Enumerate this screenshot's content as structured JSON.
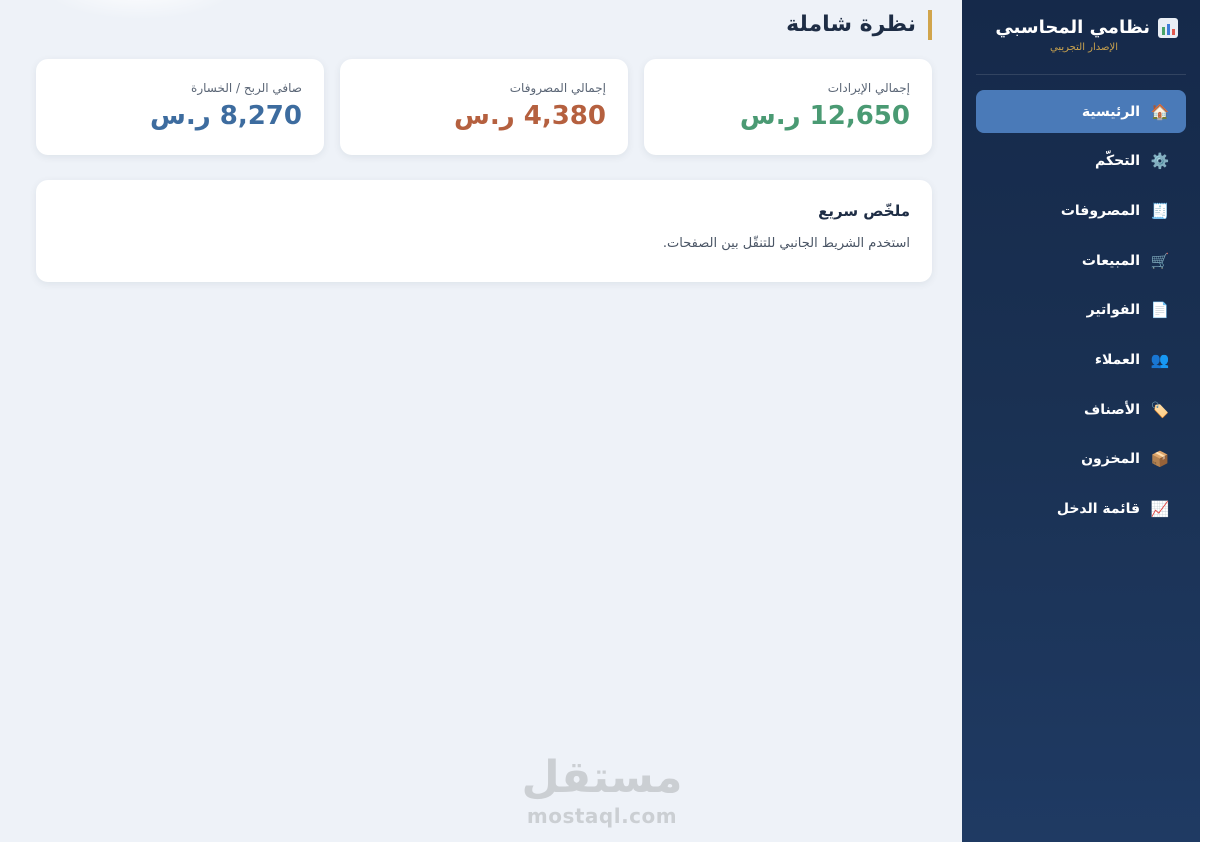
{
  "app": {
    "title": "نظامي المحاسبي",
    "subtitle": "الإصدار التجريبي",
    "brand_icon": "bar-chart-icon"
  },
  "header": {
    "title": "نظرة شاملة"
  },
  "stats": [
    {
      "label": "إجمالي الإيرادات",
      "value": "12,650 ر.س",
      "color": "#4a9a73"
    },
    {
      "label": "إجمالي المصروفات",
      "value": "4,380 ر.س",
      "color": "#b5603f"
    },
    {
      "label": "صافي الربح / الخسارة",
      "value": "8,270 ر.س",
      "color": "#3d6c9f"
    }
  ],
  "summary": {
    "title": "ملخّص سريع",
    "text": "استخدم الشريط الجانبي للتنقّل بين الصفحات."
  },
  "sidebar": {
    "items": [
      {
        "label": "الرئيسية",
        "icon": "home-icon",
        "glyph": "🏠",
        "active": true
      },
      {
        "label": "التحكّم",
        "icon": "gear-icon",
        "glyph": "⚙️"
      },
      {
        "label": "المصروفات",
        "icon": "receipt-icon",
        "glyph": "🧾"
      },
      {
        "label": "المبيعات",
        "icon": "cart-icon",
        "glyph": "🛒"
      },
      {
        "label": "الفواتير",
        "icon": "document-icon",
        "glyph": "📄"
      },
      {
        "label": "العملاء",
        "icon": "users-icon",
        "glyph": "👥"
      },
      {
        "label": "الأصناف",
        "icon": "tag-icon",
        "glyph": "🏷️"
      },
      {
        "label": "المخزون",
        "icon": "box-icon",
        "glyph": "📦"
      },
      {
        "label": "قائمة الدخل",
        "icon": "chart-up-icon",
        "glyph": "📈"
      }
    ]
  },
  "watermark": {
    "logo": "مستقل",
    "url": "mostaql.com"
  },
  "colors": {
    "accent": "#4a7ab8",
    "gold": "#d1a54c",
    "sidebar": "#1a3153",
    "background": "#eef2f8"
  }
}
